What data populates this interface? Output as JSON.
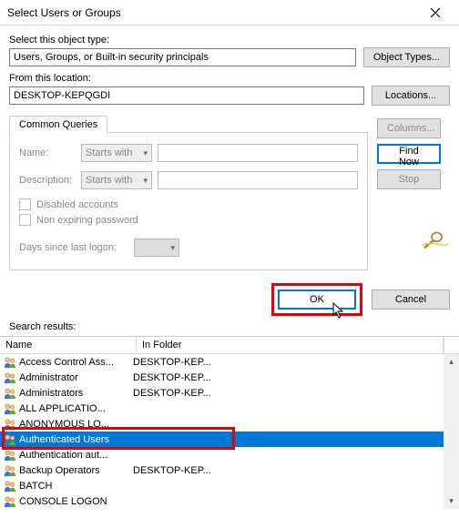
{
  "window": {
    "title": "Select Users or Groups"
  },
  "object_type": {
    "label": "Select this object type:",
    "value": "Users, Groups, or Built-in security principals",
    "button": "Object Types..."
  },
  "location": {
    "label": "From this location:",
    "value": "DESKTOP-KEPQGDI",
    "button": "Locations..."
  },
  "queries": {
    "tab": "Common Queries",
    "name_label": "Name:",
    "name_mode": "Starts with",
    "desc_label": "Description:",
    "desc_mode": "Starts with",
    "cb_disabled": "Disabled accounts",
    "cb_nonexpiring": "Non expiring password",
    "days_label": "Days since last logon:"
  },
  "side": {
    "columns": "Columns...",
    "find_now": "Find Now",
    "stop": "Stop"
  },
  "actions": {
    "ok": "OK",
    "cancel": "Cancel"
  },
  "results": {
    "label": "Search results:",
    "col_name": "Name",
    "col_folder": "In Folder",
    "rows": [
      {
        "name": "Access Control Ass...",
        "folder": "DESKTOP-KEP..."
      },
      {
        "name": "Administrator",
        "folder": "DESKTOP-KEP..."
      },
      {
        "name": "Administrators",
        "folder": "DESKTOP-KEP..."
      },
      {
        "name": "ALL APPLICATIO...",
        "folder": ""
      },
      {
        "name": "ANONYMOUS LO...",
        "folder": ""
      },
      {
        "name": "Authenticated Users",
        "folder": ""
      },
      {
        "name": "Authentication aut...",
        "folder": ""
      },
      {
        "name": "Backup Operators",
        "folder": "DESKTOP-KEP..."
      },
      {
        "name": "BATCH",
        "folder": ""
      },
      {
        "name": "CONSOLE LOGON",
        "folder": ""
      }
    ],
    "selected_index": 5
  }
}
